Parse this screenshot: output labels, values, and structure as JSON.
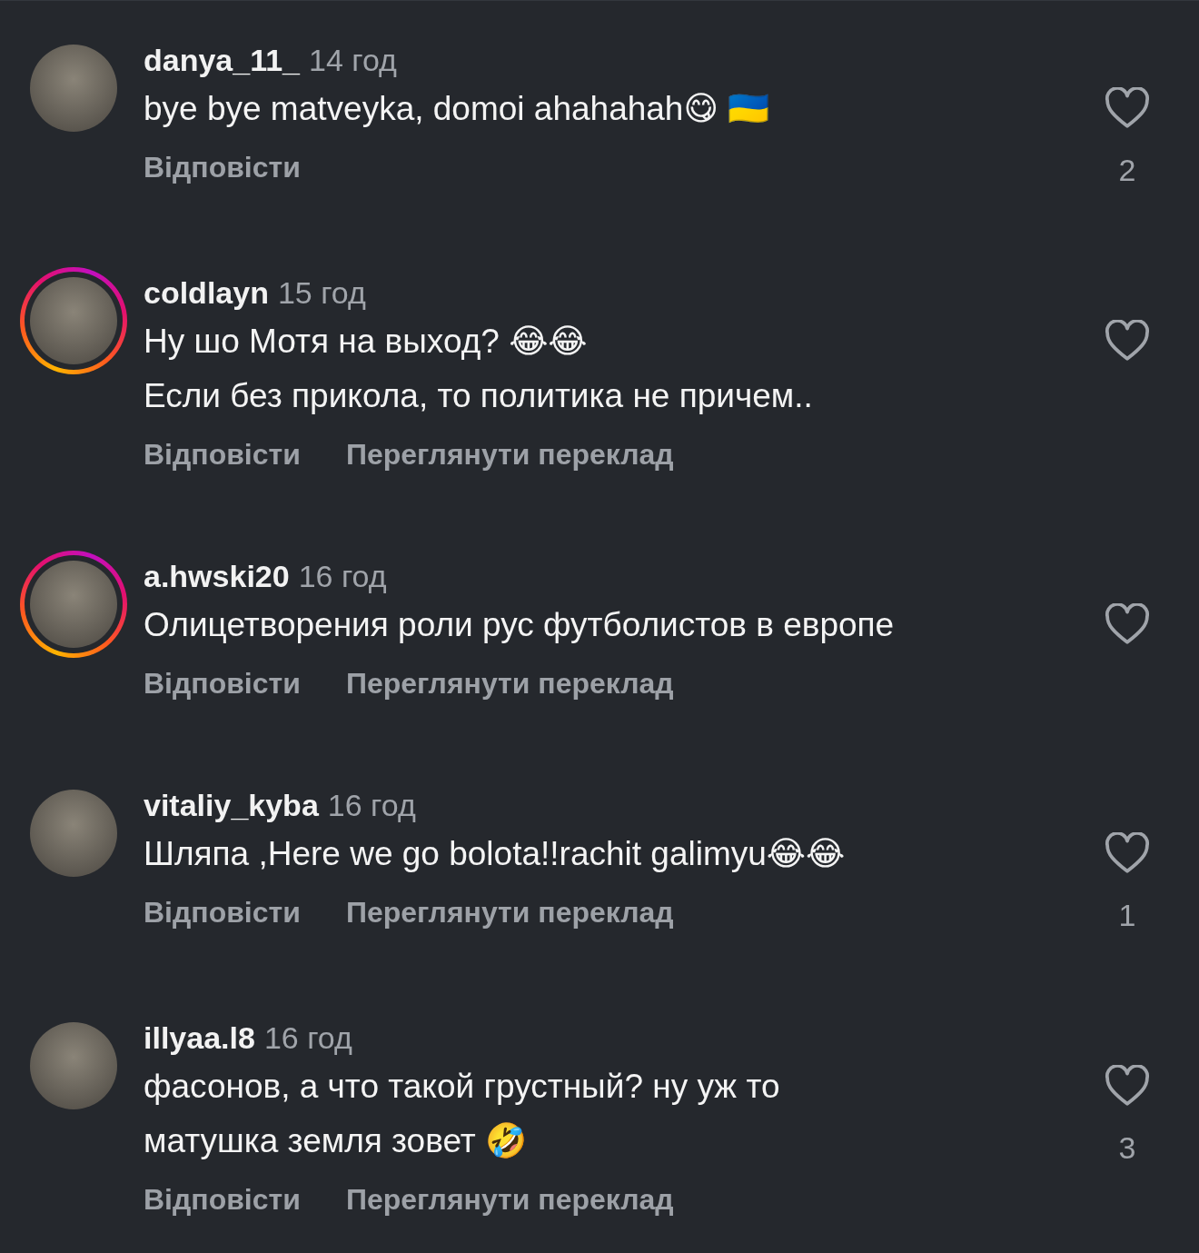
{
  "comments": [
    {
      "username": "danya_11_",
      "time": "14 год",
      "story_ring": false,
      "lines": [
        "bye bye matveyka, domoi ahahahah😋 🇺🇦"
      ],
      "actions": [
        "Відповісти"
      ],
      "likes": "2"
    },
    {
      "username": "coldlayn",
      "time": "15 год",
      "story_ring": true,
      "lines": [
        "Ну шо Мотя на выход? 😂😂",
        "Если без прикола, то политика не причем.."
      ],
      "actions": [
        "Відповісти",
        "Переглянути переклад"
      ]
    },
    {
      "username": "a.hwski20",
      "time": "16 год",
      "story_ring": true,
      "lines": [
        "Олицетворения роли рус футболистов в европе"
      ],
      "actions": [
        "Відповісти",
        "Переглянути переклад"
      ]
    },
    {
      "username": "vitaliy_kyba",
      "time": "16 год",
      "story_ring": false,
      "lines": [
        "Шляпа ,Here we go bolota!!rachit galimyu😂😂"
      ],
      "actions": [
        "Відповісти",
        "Переглянути переклад"
      ],
      "likes": "1"
    },
    {
      "username": "illyaa.l8",
      "time": "16 год",
      "story_ring": false,
      "lines": [
        "фасонов, а что такой грустный? ну уж то",
        "матушка земля зовет 🤣"
      ],
      "actions": [
        "Відповісти",
        "Переглянути переклад"
      ],
      "likes": "3"
    }
  ]
}
